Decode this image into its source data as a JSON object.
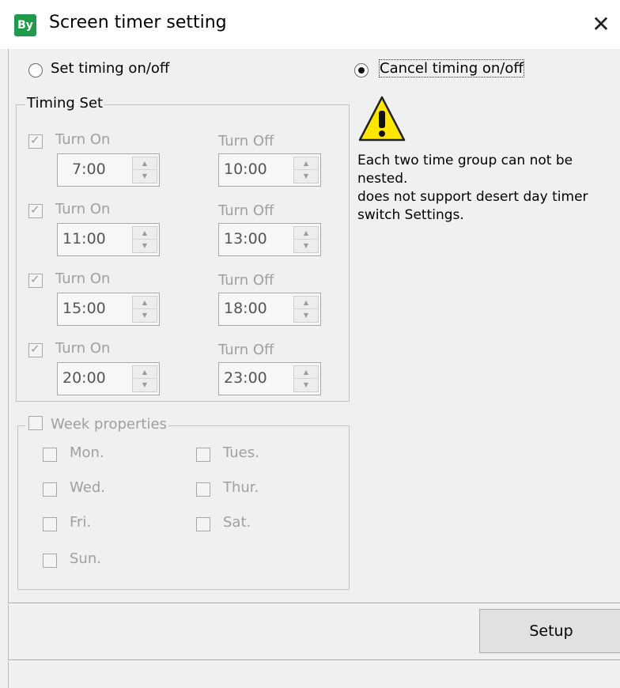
{
  "window": {
    "app_icon_text": "By",
    "title": "Screen timer setting",
    "close_glyph": "✕"
  },
  "mode": {
    "set_label": "Set timing on/off",
    "cancel_label": "Cancel timing on/off",
    "selected": "cancel"
  },
  "timing_set": {
    "legend": "Timing Set",
    "turn_on_label": "Turn On",
    "turn_off_label": "Turn Off",
    "groups": [
      {
        "on_checked": true,
        "on": "7:00",
        "off": "10:00"
      },
      {
        "on_checked": true,
        "on": "11:00",
        "off": "13:00"
      },
      {
        "on_checked": true,
        "on": "15:00",
        "off": "18:00"
      },
      {
        "on_checked": true,
        "on": "20:00",
        "off": "23:00"
      }
    ]
  },
  "week": {
    "legend": "Week properties",
    "checked": false,
    "days": {
      "mon": "Mon.",
      "tues": "Tues.",
      "wed": "Wed.",
      "thur": "Thur.",
      "fri": "Fri.",
      "sat": "Sat.",
      "sun": "Sun."
    }
  },
  "warning": {
    "icon": "warning-icon",
    "line1": "Each two time group can not be",
    "line2": "nested.",
    "line3": "does not support desert day timer",
    "line4": "switch Settings."
  },
  "footer": {
    "setup_label": "Setup"
  },
  "colors": {
    "dialog_bg": "#f0f0f0",
    "disabled_text": "#a0a0a0",
    "app_icon": "#1f9a4a",
    "warning_yellow": "#ffe600"
  }
}
